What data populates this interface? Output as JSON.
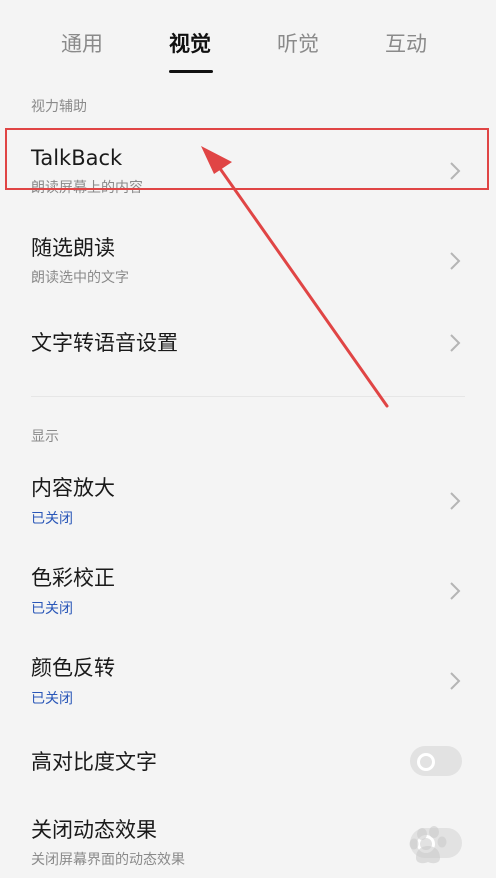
{
  "tabs": [
    {
      "label": "通用",
      "active": false
    },
    {
      "label": "视觉",
      "active": true
    },
    {
      "label": "听觉",
      "active": false
    },
    {
      "label": "互动",
      "active": false
    }
  ],
  "sections": {
    "vision_aids": {
      "header": "视力辅助",
      "items": [
        {
          "title": "TalkBack",
          "subtitle": "朗读屏幕上的内容"
        },
        {
          "title": "随选朗读",
          "subtitle": "朗读选中的文字"
        },
        {
          "title": "文字转语音设置"
        }
      ]
    },
    "display": {
      "header": "显示",
      "items": [
        {
          "title": "内容放大",
          "status": "已关闭"
        },
        {
          "title": "色彩校正",
          "status": "已关闭"
        },
        {
          "title": "颜色反转",
          "status": "已关闭"
        },
        {
          "title": "高对比度文字",
          "toggle_on": false
        },
        {
          "title": "关闭动态效果",
          "subtitle": "关闭屏幕界面的动态效果"
        }
      ]
    }
  },
  "annotation": {
    "color": "#e04545"
  },
  "colors": {
    "background": "#f4f4f4",
    "status_blue": "#2a57b8",
    "secondary_text": "#8a8a8a"
  },
  "icons": {
    "chevron": "chevron-right-icon",
    "watermark": "baidu-paw-icon"
  }
}
